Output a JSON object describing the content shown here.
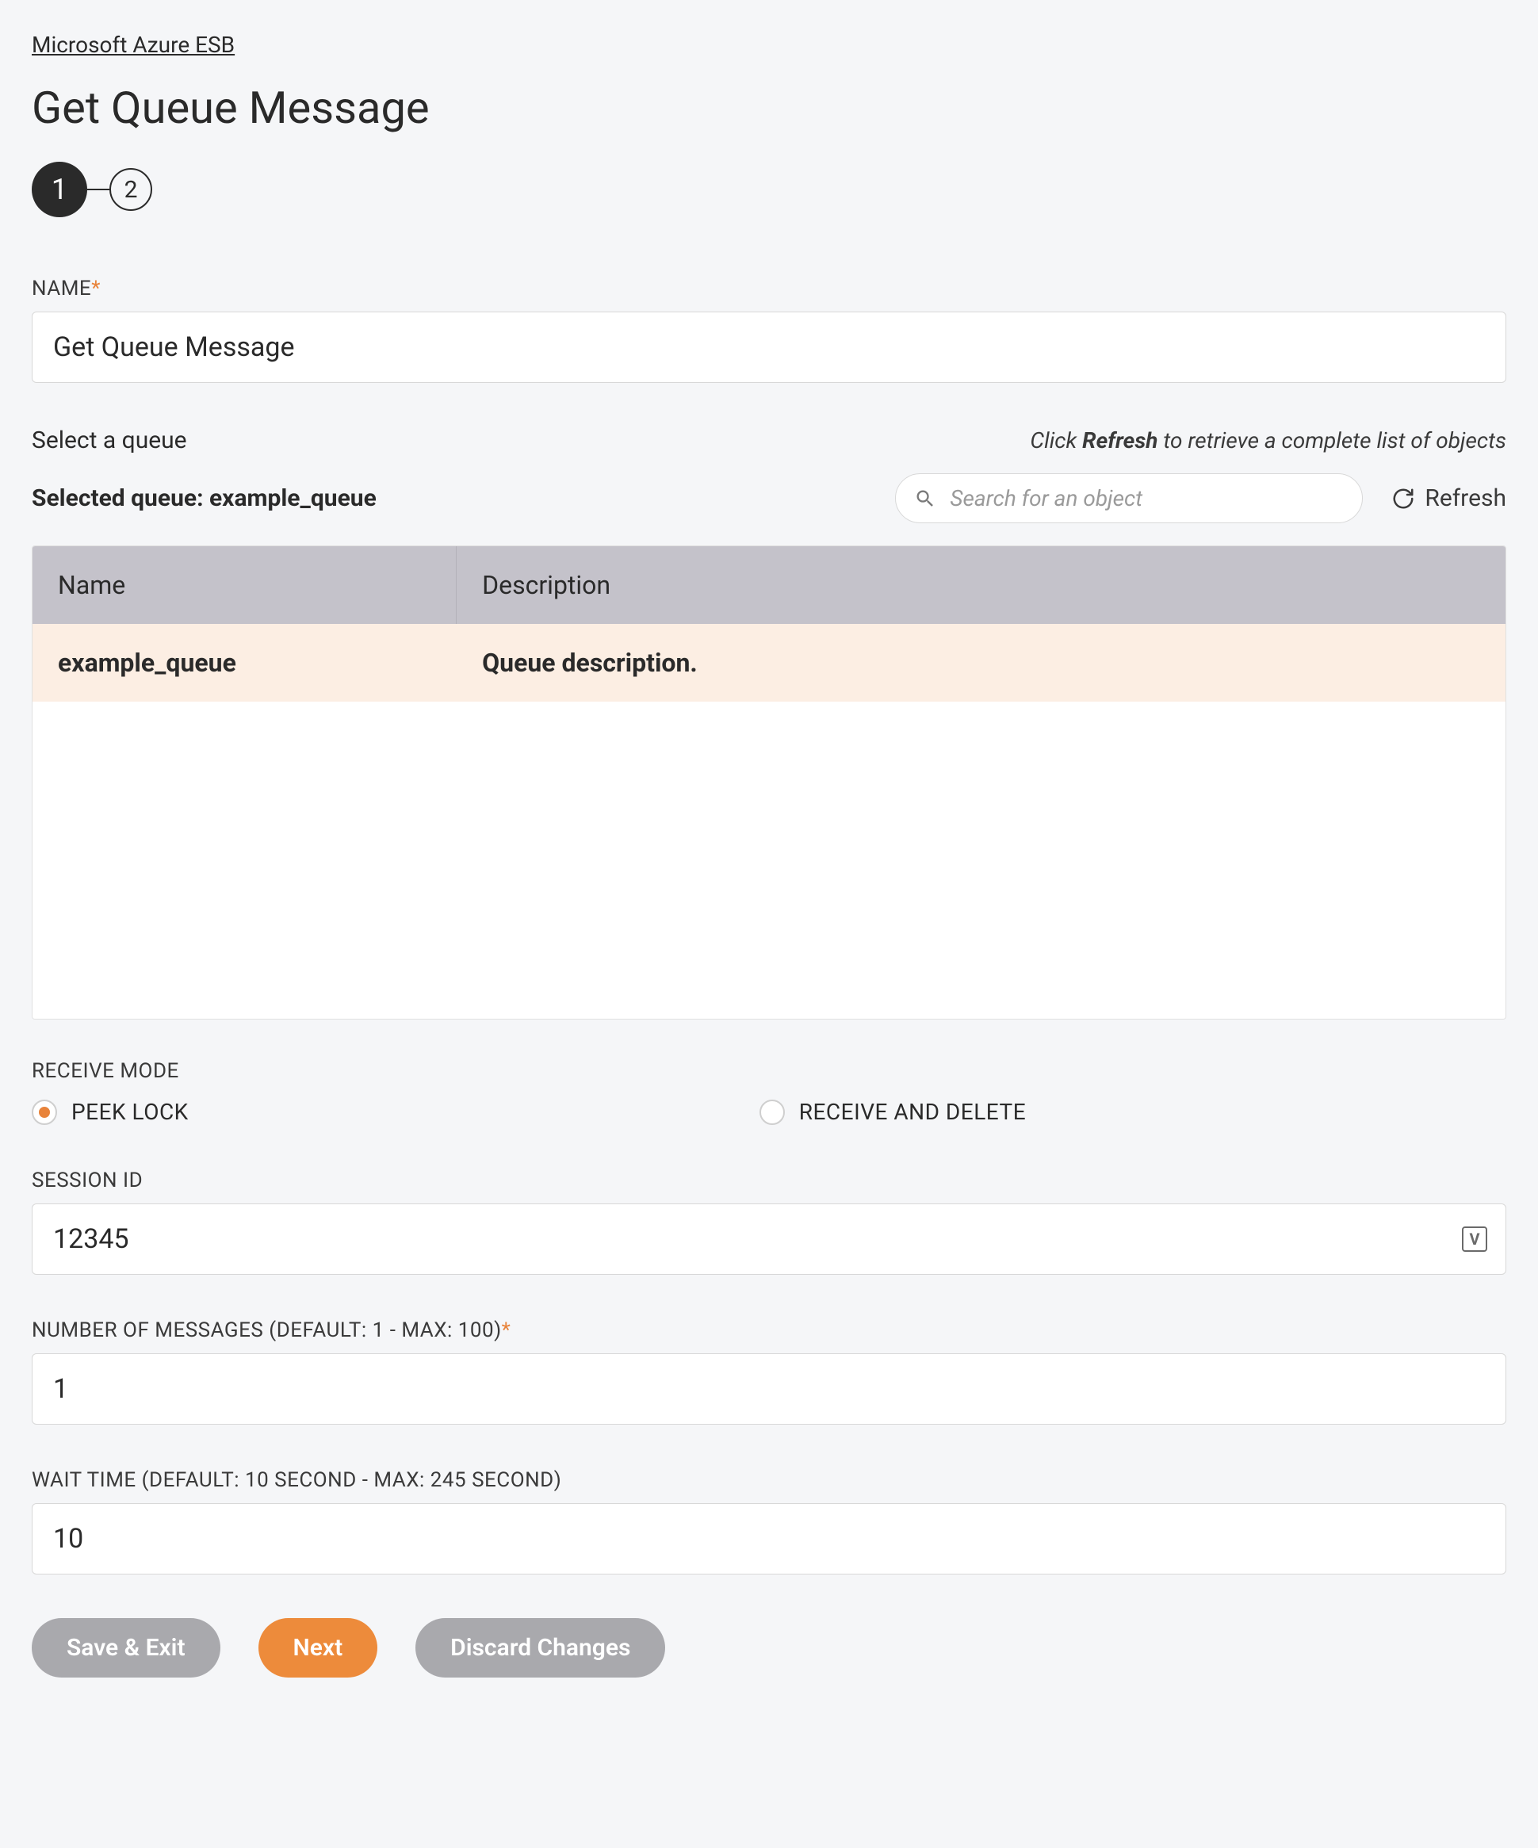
{
  "breadcrumb": "Microsoft Azure ESB",
  "page_title": "Get Queue Message",
  "stepper": {
    "steps": [
      "1",
      "2"
    ],
    "active": 0
  },
  "name_field": {
    "label": "NAME",
    "value": "Get Queue Message"
  },
  "queue": {
    "select_label": "Select a queue",
    "hint_prefix": "Click ",
    "hint_bold": "Refresh",
    "hint_suffix": " to retrieve a complete list of objects",
    "selected_prefix": "Selected queue: ",
    "selected_value": "example_queue",
    "search_placeholder": "Search for an object",
    "refresh_label": "Refresh",
    "table": {
      "headers": {
        "name": "Name",
        "description": "Description"
      },
      "rows": [
        {
          "name": "example_queue",
          "description": "Queue description."
        }
      ]
    }
  },
  "receive_mode": {
    "label": "RECEIVE MODE",
    "options": [
      {
        "label": "PEEK LOCK",
        "checked": true
      },
      {
        "label": "RECEIVE AND DELETE",
        "checked": false
      }
    ]
  },
  "session_id": {
    "label": "SESSION ID",
    "value": "12345"
  },
  "num_messages": {
    "label": "NUMBER OF MESSAGES (DEFAULT: 1 - MAX: 100)",
    "value": "1"
  },
  "wait_time": {
    "label": "WAIT TIME (DEFAULT: 10 SECOND - MAX: 245 SECOND)",
    "value": "10"
  },
  "buttons": {
    "save_exit": "Save & Exit",
    "next": "Next",
    "discard": "Discard Changes"
  }
}
